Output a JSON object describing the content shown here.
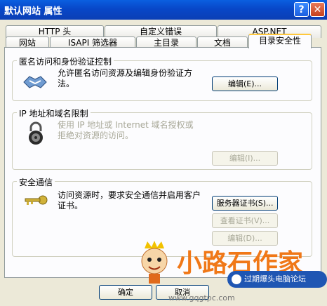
{
  "window": {
    "title": "默认网站 属性",
    "help_glyph": "?",
    "close_glyph": "✕"
  },
  "tabs_row1": [
    "HTTP 头",
    "自定义错误",
    "ASP.NET"
  ],
  "tabs_row2": [
    "网站",
    "ISAPI 筛选器",
    "主目录",
    "文档",
    "目录安全性"
  ],
  "active_tab": "目录安全性",
  "sections": {
    "anon": {
      "legend": "匿名访问和身份验证控制",
      "text_line1": "允许匿名访问资源及编辑身份验证方",
      "text_line2": "法。",
      "button": "编辑(E)..."
    },
    "ip": {
      "legend": "IP 地址和域名限制",
      "text_line1": "使用 IP 地址或 Internet 域名授权或",
      "text_line2": "拒绝对资源的访问。",
      "button": "编辑(I)...",
      "enabled": false
    },
    "secure": {
      "legend": "安全通信",
      "text_line1": "访问资源时，要求安全通信并启用客户",
      "text_line2": "证书。",
      "button_cert": "服务器证书(S)...",
      "button_view": "查看证书(V)...",
      "button_edit": "编辑(D)...",
      "view_enabled": false,
      "edit_enabled": false
    }
  },
  "dialog_buttons": {
    "ok": "确定",
    "cancel": "取消"
  },
  "watermark": {
    "brand": "小路石作家",
    "url": "www.gqgtpc.com",
    "tag": "过期爆头电脑论坛"
  }
}
